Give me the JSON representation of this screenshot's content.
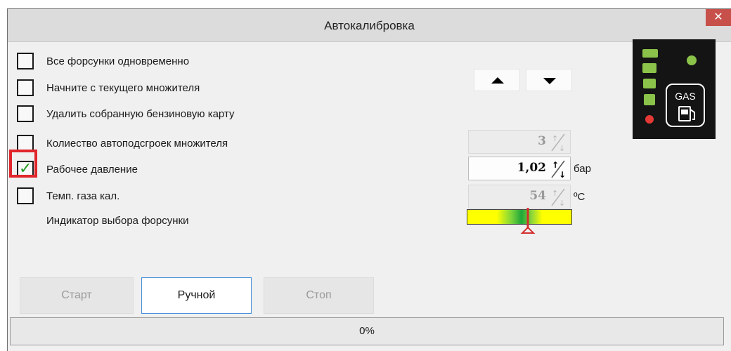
{
  "window": {
    "title": "Автокалибровка",
    "close_symbol": "✕"
  },
  "options": [
    {
      "label": "Все форсунки одновременно",
      "checked": false
    },
    {
      "label": "Начните с текущего множителя",
      "checked": false
    },
    {
      "label": "Удалить собранную бензиновую карту",
      "checked": false
    },
    {
      "label": "Колиество автоподсгроек множителя",
      "checked": false
    },
    {
      "label": "Рабочее давление",
      "checked": true
    },
    {
      "label": "Темп. газа кал.",
      "checked": false
    }
  ],
  "injector_indicator": {
    "label": "Индикатор выбора форсунки",
    "level_fraction": 0.58
  },
  "spinners": {
    "autotune_count": {
      "value": "3",
      "enabled": false
    },
    "pressure": {
      "value": "1,02",
      "unit": "бар",
      "enabled": true
    },
    "gas_temp": {
      "value": "54",
      "unit": "ºC",
      "enabled": false
    }
  },
  "status_panel": {
    "gas_label": "GAS",
    "fuel_bar_colors": [
      "#8bc34a",
      "#8bc34a",
      "#8bc34a",
      "#8bc34a"
    ],
    "led_top_color": "#8bc34a",
    "led_bottom_color": "#e53935"
  },
  "buttons": {
    "start": "Старт",
    "manual": "Ручной",
    "stop": "Стоп"
  },
  "progress": {
    "text": "0%",
    "value": 0
  },
  "colors": {
    "highlight": "#e0262b",
    "check": "#1e9a1e",
    "close": "#c7504b"
  }
}
